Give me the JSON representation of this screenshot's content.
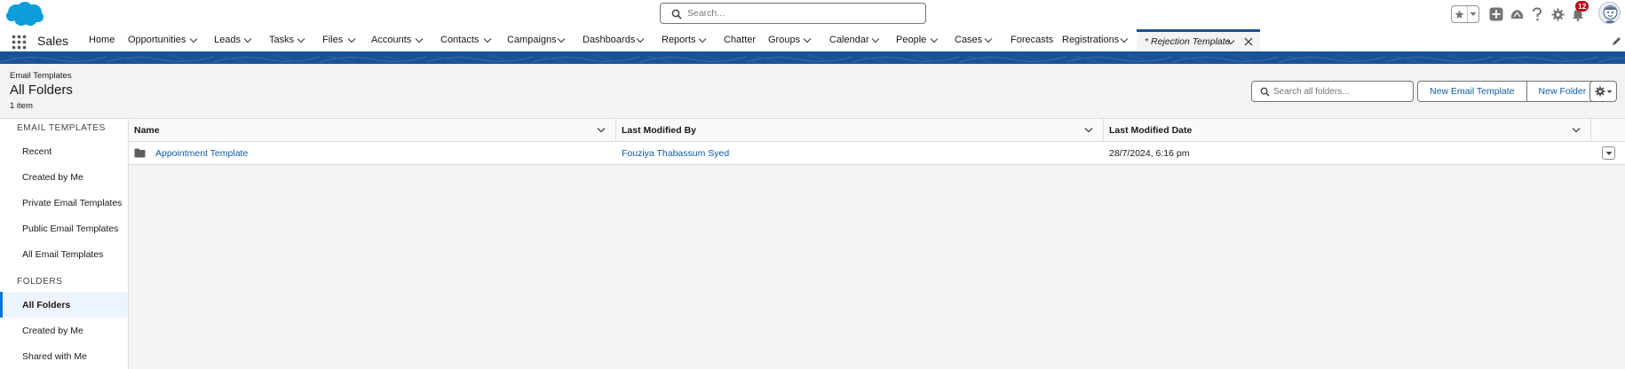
{
  "header": {
    "search_placeholder": "Search...",
    "notification_count": "12"
  },
  "nav": {
    "app_name": "Sales",
    "items": [
      {
        "label": "Home",
        "has_menu": false
      },
      {
        "label": "Opportunities",
        "has_menu": true
      },
      {
        "label": "Leads",
        "has_menu": true
      },
      {
        "label": "Tasks",
        "has_menu": true
      },
      {
        "label": "Files",
        "has_menu": true
      },
      {
        "label": "Accounts",
        "has_menu": true
      },
      {
        "label": "Contacts",
        "has_menu": true
      },
      {
        "label": "Campaigns",
        "has_menu": true
      },
      {
        "label": "Dashboards",
        "has_menu": true
      },
      {
        "label": "Reports",
        "has_menu": true
      },
      {
        "label": "Chatter",
        "has_menu": false
      },
      {
        "label": "Groups",
        "has_menu": true
      },
      {
        "label": "Calendar",
        "has_menu": true
      },
      {
        "label": "People",
        "has_menu": true
      },
      {
        "label": "Cases",
        "has_menu": true
      },
      {
        "label": "Forecasts",
        "has_menu": false
      },
      {
        "label": "Registrations",
        "has_menu": true
      }
    ],
    "active_tab": "* Rejection Template"
  },
  "page": {
    "object_label": "Email Templates",
    "title": "All Folders",
    "item_count": "1 item",
    "folder_search_placeholder": "Search all folders...",
    "new_template_button": "New Email Template",
    "new_folder_button": "New Folder"
  },
  "sidebar": {
    "section1": "Email Templates",
    "section1_items": [
      "Recent",
      "Created by Me",
      "Private Email Templates",
      "Public Email Templates",
      "All Email Templates"
    ],
    "section2": "Folders",
    "section2_items": [
      "All Folders",
      "Created by Me",
      "Shared with Me"
    ],
    "active_item": "All Folders"
  },
  "table": {
    "columns": [
      "Name",
      "Last Modified By",
      "Last Modified Date"
    ],
    "rows": [
      {
        "name": "Appointment Template",
        "modified_by": "Fouziya Thabassum Syed",
        "modified_date": "28/7/2024, 6:16 pm"
      }
    ]
  },
  "colors": {
    "brand_blue": "#1b5297",
    "link_blue": "#0b5cab",
    "badge_red": "#ba0517"
  }
}
